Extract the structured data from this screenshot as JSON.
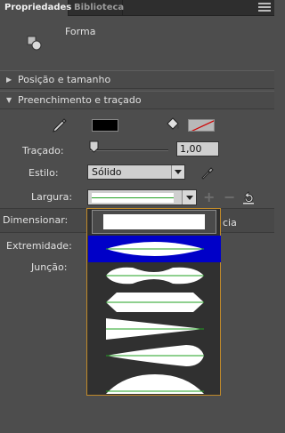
{
  "tabs": [
    {
      "label": "Propriedades",
      "active": true
    },
    {
      "label": "Biblioteca",
      "active": false
    }
  ],
  "object": {
    "type_label": "Forma"
  },
  "sections": {
    "position": {
      "label": "Posição e tamanho",
      "expanded": false
    },
    "fill_stroke": {
      "label": "Preenchimento e traçado",
      "expanded": true
    }
  },
  "fields": {
    "stroke_label": "Traçado:",
    "stroke_value": "1,00",
    "style_label": "Estilo:",
    "style_value": "Sólido",
    "width_label": "Largura:",
    "scale_label": "Dimensionar:",
    "scale_right_text": "cia",
    "cap_label": "Extremidade:",
    "join_label": "Junção:"
  },
  "colors": {
    "stroke": "#000000",
    "fill": "none",
    "dropdown_selected": "#0000c8",
    "width_guide": "#1fa01f",
    "dropdown_border": "#c08a2a"
  },
  "width_profiles": [
    {
      "name": "uniform",
      "selected": false
    },
    {
      "name": "profile-1",
      "selected": true
    },
    {
      "name": "profile-2",
      "selected": false
    },
    {
      "name": "profile-3",
      "selected": false
    },
    {
      "name": "profile-4",
      "selected": false
    },
    {
      "name": "profile-5",
      "selected": false
    },
    {
      "name": "profile-6",
      "selected": false
    }
  ]
}
